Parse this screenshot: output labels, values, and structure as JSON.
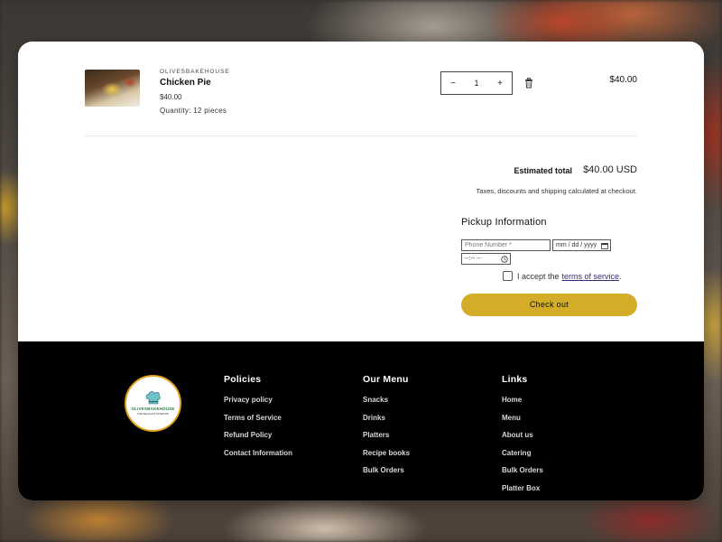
{
  "cart": {
    "item": {
      "vendor": "OLIVESBAKEHOUSE",
      "name": "Chicken Pie",
      "price": "$40.00",
      "quantity_note": "Quantity: 12 pieces",
      "quantity_value": "1",
      "decrement_label": "−",
      "increment_label": "+",
      "line_total": "$40.00"
    },
    "summary": {
      "estimated_total_label": "Estimated total",
      "estimated_total_value": "$40.00 USD",
      "tax_note": "Taxes, discounts and shipping calculated at checkout."
    },
    "pickup": {
      "title": "Pickup Information",
      "phone_placeholder": "Phone Number *",
      "date_placeholder": "mm / dd / yyyy",
      "time_placeholder": "--:-- --",
      "tos_prefix": "I accept the",
      "tos_link": "terms of service",
      "tos_suffix": "."
    },
    "checkout_label": "Check out"
  },
  "footer": {
    "logo": {
      "name": "OLIVESBAKEHOUSE",
      "tagline": "THE DELIGHTS IN BAKING"
    },
    "columns": [
      {
        "title": "Policies",
        "items": [
          "Privacy policy",
          "Terms of Service",
          "Refund Policy",
          "Contact Information"
        ]
      },
      {
        "title": "Our Menu",
        "items": [
          "Snacks",
          "Drinks",
          "Platters",
          "Recipe books",
          "Bulk Orders"
        ]
      },
      {
        "title": "Links",
        "items": [
          "Home",
          "Menu",
          "About us",
          "Catering",
          "Bulk Orders",
          "Platter Box"
        ]
      }
    ]
  },
  "colors": {
    "accent": "#d3ad27",
    "link": "#3a2a7a",
    "footer_bg": "#000000"
  },
  "icons": {
    "trash": "trash-icon",
    "calendar": "calendar-icon",
    "clock": "clock-icon",
    "chef_hat": "chef-hat-icon"
  }
}
